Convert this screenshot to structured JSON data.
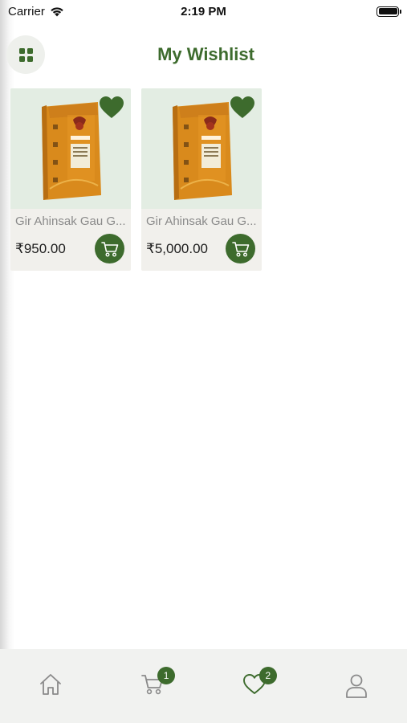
{
  "status_bar": {
    "carrier": "Carrier",
    "time": "2:19 PM"
  },
  "header": {
    "title": "My Wishlist",
    "menu_icon": "grid-icon"
  },
  "colors": {
    "accent": "#3d6b2d",
    "card_bg": "#f1f0ec",
    "image_bg": "#e3ede3",
    "tab_bar_bg": "#f1f2f0"
  },
  "products": [
    {
      "name": "Gir Ahinsak Gau G...",
      "price": "₹950.00",
      "wishlisted": true
    },
    {
      "name": "Gir Ahinsak Gau G...",
      "price": "₹5,000.00",
      "wishlisted": true
    }
  ],
  "tab_bar": {
    "tabs": [
      {
        "icon": "home-icon"
      },
      {
        "icon": "cart-icon",
        "badge": "1"
      },
      {
        "icon": "heart-icon",
        "badge": "2"
      },
      {
        "icon": "profile-icon"
      }
    ]
  }
}
